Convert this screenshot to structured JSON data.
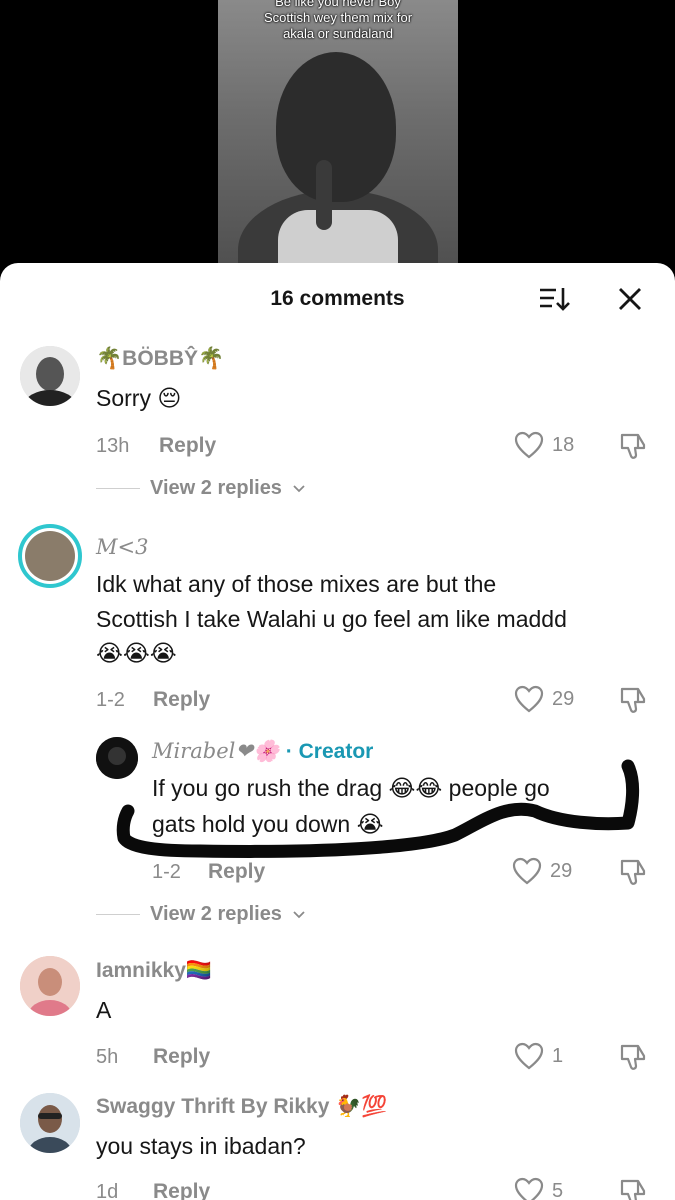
{
  "video": {
    "caption_lines": [
      "Be like you never Boy",
      "Scottish wey them mix for",
      "akala or sundaland"
    ]
  },
  "sheet": {
    "title": "16 comments"
  },
  "comments": [
    {
      "username": "🌴BÖBBŶ🌴",
      "text": "Sorry 😔",
      "time": "13h",
      "reply_label": "Reply",
      "likes": "18",
      "view_replies": "View 2 replies"
    },
    {
      "username": "M<3",
      "text_lines": [
        "Idk what any of those mixes are but the",
        "Scottish I take Walahi u go feel am like maddd",
        "😭😭😭"
      ],
      "time": "1-2",
      "reply_label": "Reply",
      "likes": "29"
    },
    {
      "username": "Mirabel❤🌸",
      "creator_label": "· Creator",
      "text_lines": [
        "If you go rush the drag 😂😂 people go",
        "gats hold you down 😭"
      ],
      "time": "1-2",
      "reply_label": "Reply",
      "likes": "29",
      "view_replies": "View 2 replies"
    },
    {
      "username": "Iamnikky🏳️‍🌈",
      "text": "A",
      "time": "5h",
      "reply_label": "Reply",
      "likes": "1"
    },
    {
      "username": "Swaggy Thrift By Rikky 🐓💯",
      "text": "you stays in ibadan?",
      "time": "1d",
      "reply_label": "Reply",
      "likes": "5"
    }
  ]
}
